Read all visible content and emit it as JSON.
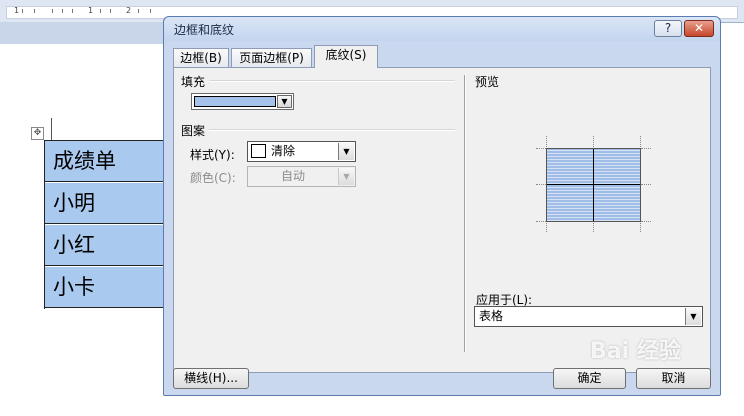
{
  "dialog": {
    "title": "边框和底纹",
    "help_label": "?",
    "close_label": "✕",
    "tabs": [
      {
        "label": "边框(B)",
        "active": false
      },
      {
        "label": "页面边框(P)",
        "active": false
      },
      {
        "label": "底纹(S)",
        "active": true
      }
    ],
    "fill": {
      "heading": "填充",
      "color": "#a4c2ec"
    },
    "pattern": {
      "heading": "图案",
      "style_label": "样式(Y):",
      "style_value": "清除",
      "color_label": "颜色(C):",
      "color_value": "自动"
    },
    "preview": {
      "heading": "预览",
      "fill_color": "#9fbde6"
    },
    "apply_to": {
      "label": "应用于(L):",
      "value": "表格"
    },
    "buttons": {
      "horizontal_line": "横线(H)...",
      "ok": "确定",
      "cancel": "取消"
    }
  },
  "document": {
    "table_rows": [
      "成绩单",
      "小明",
      "小红",
      "小卡"
    ],
    "cell_color": "#a9c9ee"
  },
  "ruler": {
    "numbers": [
      "1",
      "1",
      "2"
    ]
  },
  "watermark": "Bai 经验"
}
